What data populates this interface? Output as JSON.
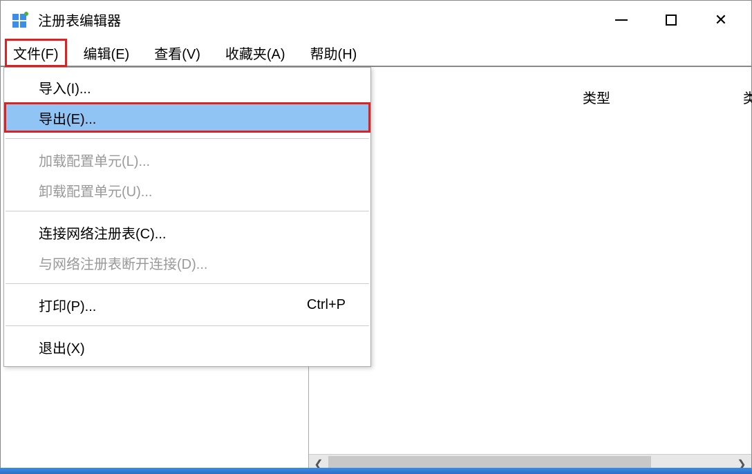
{
  "titlebar": {
    "title": "注册表编辑器"
  },
  "menubar": {
    "items": [
      {
        "label": "文件(F)",
        "highlighted": true
      },
      {
        "label": "编辑(E)"
      },
      {
        "label": "查看(V)"
      },
      {
        "label": "收藏夹(A)"
      },
      {
        "label": "帮助(H)"
      }
    ]
  },
  "dropdown": {
    "items": [
      {
        "label": "导入(I)...",
        "enabled": true
      },
      {
        "label": "导出(E)...",
        "enabled": true,
        "highlighted": true
      },
      {
        "separator": true
      },
      {
        "label": "加载配置单元(L)...",
        "enabled": false
      },
      {
        "label": "卸载配置单元(U)...",
        "enabled": false
      },
      {
        "separator": true
      },
      {
        "label": "连接网络注册表(C)...",
        "enabled": true
      },
      {
        "label": "与网络注册表断开连接(D)...",
        "enabled": false
      },
      {
        "separator": true
      },
      {
        "label": "打印(P)...",
        "enabled": true,
        "shortcut": "Ctrl+P"
      },
      {
        "separator": true
      },
      {
        "label": "退出(X)",
        "enabled": true
      }
    ]
  },
  "columns": {
    "type": "类型",
    "partial": "类"
  }
}
